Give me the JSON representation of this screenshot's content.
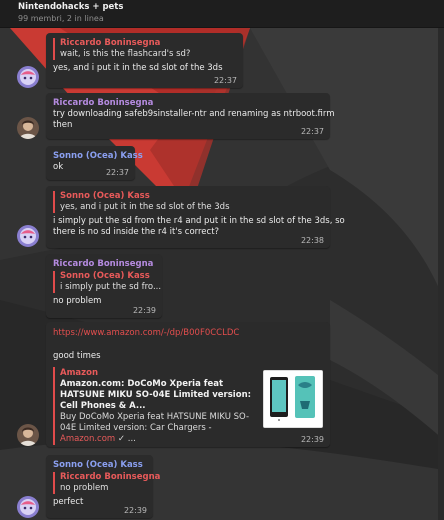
{
  "header": {
    "title": "Nintendohacks + pets",
    "subtitle": "99 membri, 2 in linea"
  },
  "colors": {
    "accent_red": "#e04b4b",
    "riccardo_name": "#b58be0",
    "sonno_name": "#8a9ff0",
    "bubble_bg": "#2b2b2b"
  },
  "messages": [
    {
      "sender": "Riccardo Boninsegna",
      "text": "yes, and i put it in the sd slot of the 3ds",
      "reply": {
        "name": "",
        "text": "wait, is this the flashcard's sd?"
      },
      "time": "22:37"
    },
    {
      "sender": "Riccardo Boninsegna",
      "text_lines": [
        "try downloading safeb9sinstaller-ntr and renaming as ntrboot.firm",
        "then"
      ],
      "time": "22:37"
    },
    {
      "sender": "Sonno (Ocea) Kass",
      "text": "ok",
      "time": "22:37"
    },
    {
      "reply": {
        "name": "Sonno (Ocea) Kass",
        "text": "yes, and i put it in the sd slot of the 3ds"
      },
      "text_lines": [
        "i simply put the sd from the r4 and put it in the sd slot of the 3ds, so",
        "there is no sd inside the r4 it's correct?"
      ],
      "time": "22:38"
    },
    {
      "sender": "Riccardo Boninsegna",
      "reply": {
        "name": "Sonno (Ocea) Kass",
        "text": "i simply put the sd fro..."
      },
      "time": ""
    },
    {
      "text": "no problem",
      "time": "22:39"
    },
    {
      "link": "https://www.amazon.com/-/dp/B00F0CCLDC",
      "text": "good times",
      "preview": {
        "site": "Amazon",
        "title": "Amazon.com: DoCoMo Xperia feat HATSUNE MIKU SO-04E Limited version: Cell Phones & A...",
        "desc": "Buy DoCoMo Xperia feat HATSUNE MIKU SO-04E Limited version: Car Chargers -",
        "desc_link": "Amazon.com",
        "desc_tail": "✓ ..."
      },
      "time": "22:39"
    },
    {
      "sender": "Sonno (Ocea) Kass",
      "reply": {
        "name": "Riccardo Boninsegna",
        "text": "no problem"
      },
      "text": "perfect",
      "time": "22:39"
    }
  ]
}
